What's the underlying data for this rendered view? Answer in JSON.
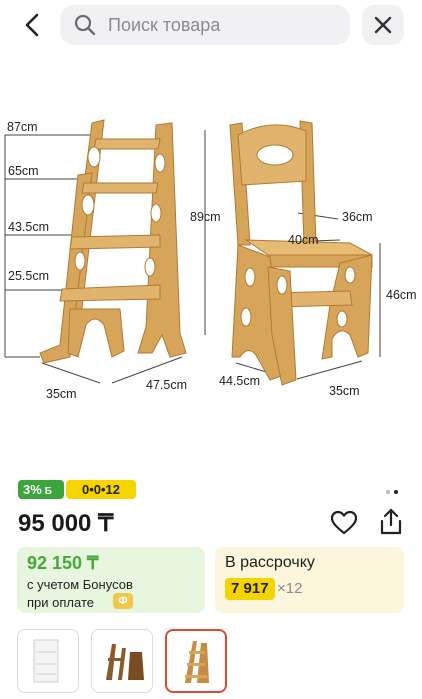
{
  "search": {
    "placeholder": "Поиск товара"
  },
  "dimensions": {
    "h87": "87cm",
    "h65": "65cm",
    "h43_5": "43.5cm",
    "h25_5": "25.5cm",
    "w35_left": "35cm",
    "d47_5": "47.5cm",
    "h89": "89cm",
    "w36": "36cm",
    "w40": "40cm",
    "h46": "46cm",
    "d44_5": "44.5cm",
    "w35_right": "35cm"
  },
  "badges": {
    "bonus": "3%",
    "bonus_icon": "Б",
    "installment": "0•0•12"
  },
  "price": "95 000 ₸",
  "bonus_card": {
    "amount": "92 150 ₸",
    "line1": "с учетом Бонусов",
    "line2": "при оплате",
    "coin_label": "Ф"
  },
  "installment_card": {
    "title": "В рассрочку",
    "amount": "7 917",
    "multiplier": "×12"
  },
  "colors": {
    "accent_green": "#44a83a",
    "accent_yellow": "#f5d500",
    "selected_border": "#e0483a"
  },
  "icons": [
    "back-arrow-icon",
    "search-icon",
    "close-icon",
    "heart-icon",
    "share-icon",
    "coin-icon"
  ]
}
